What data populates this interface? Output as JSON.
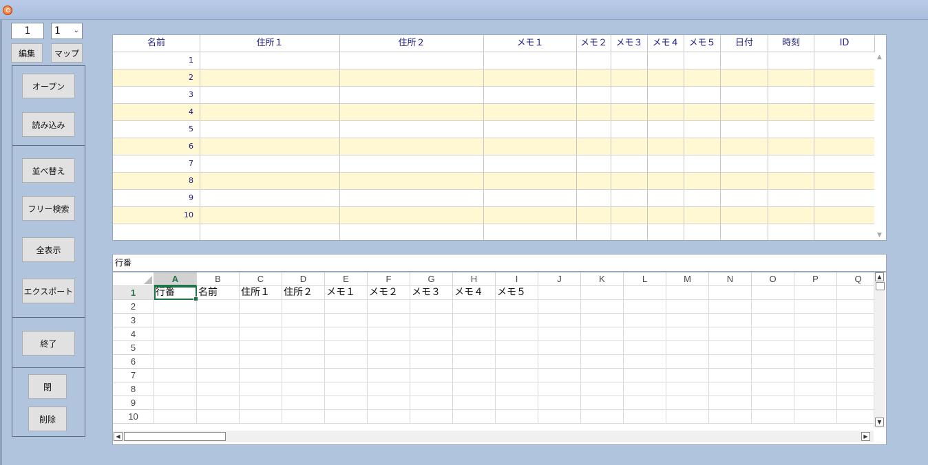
{
  "toolbar": {
    "record_input_value": "1",
    "page_select_value": "1",
    "edit_label": "編集",
    "map_label": "マップ"
  },
  "buttons": {
    "open": "オープン",
    "load": "読み込み",
    "sort": "並べ替え",
    "free_search": "フリー検索",
    "show_all": "全表示",
    "export": "エクスポート",
    "quit": "終了",
    "close": "閉",
    "delete": "削除"
  },
  "grid": {
    "columns": [
      "名前",
      "住所１",
      "住所２",
      "メモ１",
      "メモ２",
      "メモ３",
      "メモ４",
      "メモ５",
      "日付",
      "時刻",
      "ID"
    ],
    "row_numbers": [
      "1",
      "2",
      "3",
      "4",
      "5",
      "6",
      "7",
      "8",
      "9",
      "10"
    ]
  },
  "name_box": {
    "value": "行番"
  },
  "sheet": {
    "columns": [
      "A",
      "B",
      "C",
      "D",
      "E",
      "F",
      "G",
      "H",
      "I",
      "J",
      "K",
      "L",
      "M",
      "N",
      "O",
      "P",
      "Q"
    ],
    "row_numbers": [
      "1",
      "2",
      "3",
      "4",
      "5",
      "6",
      "7",
      "8",
      "9",
      "10"
    ],
    "row1": [
      "行番",
      "名前",
      "住所１",
      "住所２",
      "メモ１",
      "メモ２",
      "メモ３",
      "メモ４",
      "メモ５"
    ],
    "selected_cell": "A1"
  },
  "colors": {
    "window_bg": "#b0c4de",
    "alt_row": "#fff8d2",
    "header_text": "#1b1b80",
    "excel_green": "#217346"
  }
}
